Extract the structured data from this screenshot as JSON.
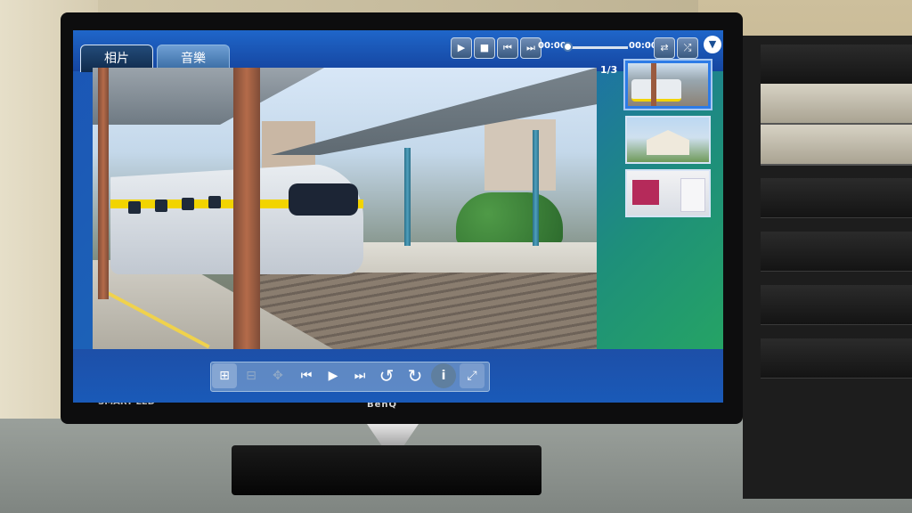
{
  "tv": {
    "brand": "BenQ",
    "logo": "SMART LED"
  },
  "tabs": [
    {
      "label": "相片",
      "active": true
    },
    {
      "label": "音樂",
      "active": false
    }
  ],
  "player": {
    "elapsed": "00:00",
    "duration": "00:00",
    "controls": [
      "play-icon",
      "stop-icon",
      "previous-icon",
      "next-icon"
    ],
    "extra": [
      "repeat-icon",
      "shuffle-icon"
    ],
    "menu_icon": "chevron-down-icon"
  },
  "gallery": {
    "counter": "1/3",
    "selected_index": 0,
    "thumbnails": [
      {
        "subject": "train"
      },
      {
        "subject": "station-building"
      },
      {
        "subject": "exhibition-room"
      }
    ]
  },
  "photo_toolbar": {
    "buttons": [
      {
        "icon": "zoom-in-icon",
        "enabled": true
      },
      {
        "icon": "zoom-out-icon",
        "enabled": false
      },
      {
        "icon": "pan-icon",
        "enabled": false
      },
      {
        "icon": "previous-icon",
        "enabled": true
      },
      {
        "icon": "play-icon",
        "enabled": true
      },
      {
        "icon": "next-icon",
        "enabled": true
      },
      {
        "icon": "rotate-left-icon",
        "enabled": true
      },
      {
        "icon": "rotate-right-icon",
        "enabled": true
      },
      {
        "icon": "info-icon",
        "enabled": true
      },
      {
        "icon": "fullscreen-icon",
        "enabled": true
      }
    ]
  },
  "colors": {
    "screen_blue": "#1b55b5",
    "screen_green": "#27a95f",
    "selection": "#2d7be6"
  }
}
